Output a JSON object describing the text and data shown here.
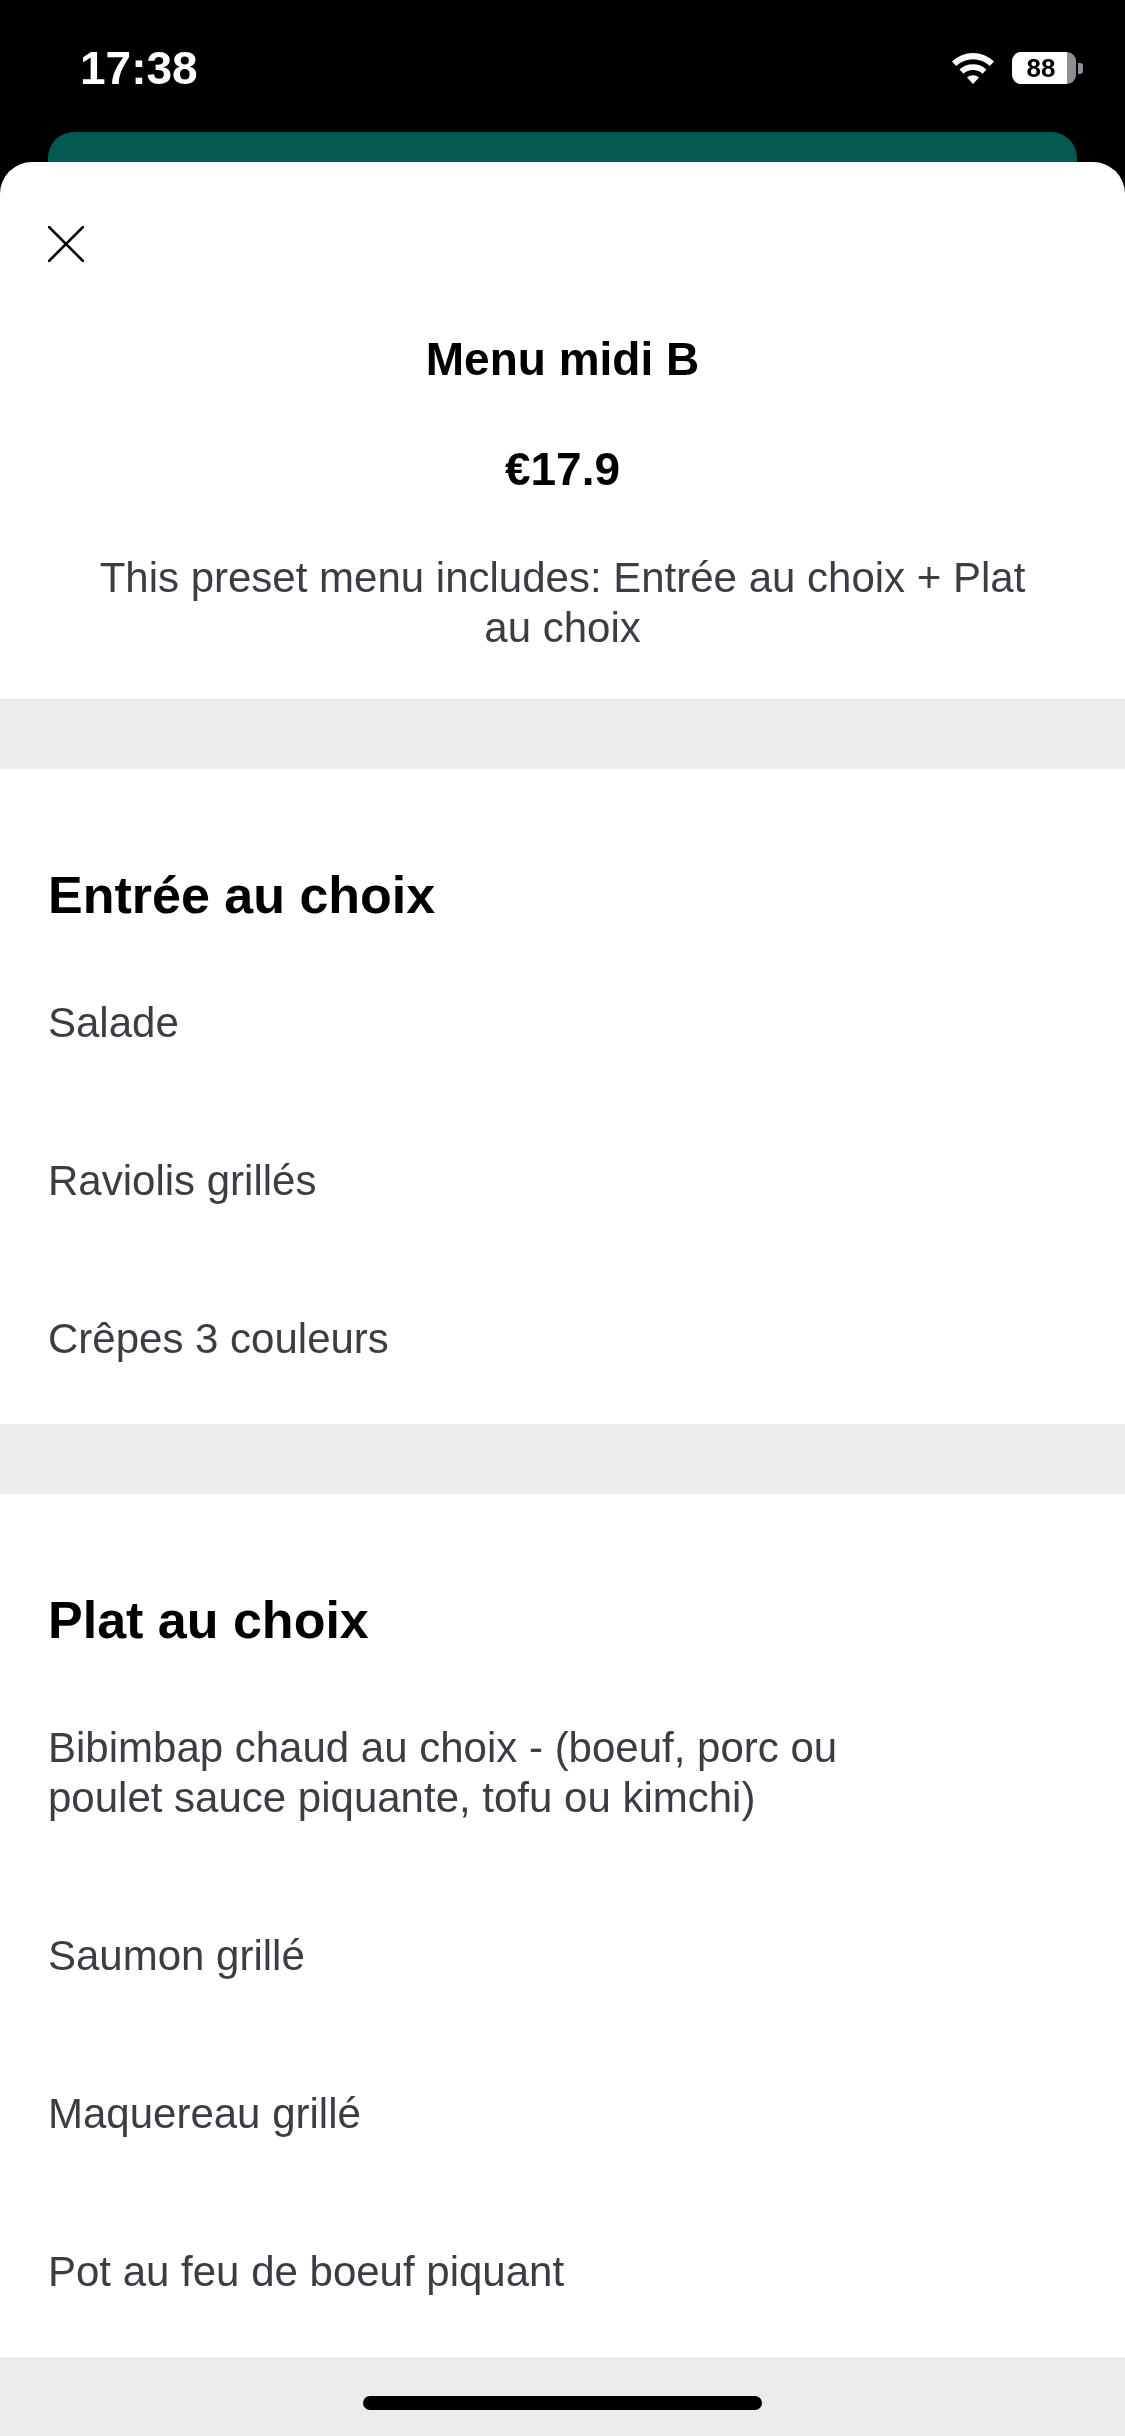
{
  "status_bar": {
    "time": "17:38",
    "battery": "88"
  },
  "sheet": {
    "title": "Menu midi B",
    "price": "€17.9",
    "description": "This preset menu includes: Entrée au choix + Plat au choix"
  },
  "sections": [
    {
      "title": "Entrée au choix",
      "items": [
        "Salade",
        "Raviolis grillés",
        "Crêpes 3 couleurs"
      ]
    },
    {
      "title": "Plat au choix",
      "items": [
        "Bibimbap chaud au choix - (boeuf, porc ou poulet sauce piquante, tofu ou kimchi)",
        "Saumon grillé",
        "Maquereau grillé",
        "Pot au feu de boeuf piquant"
      ]
    }
  ]
}
